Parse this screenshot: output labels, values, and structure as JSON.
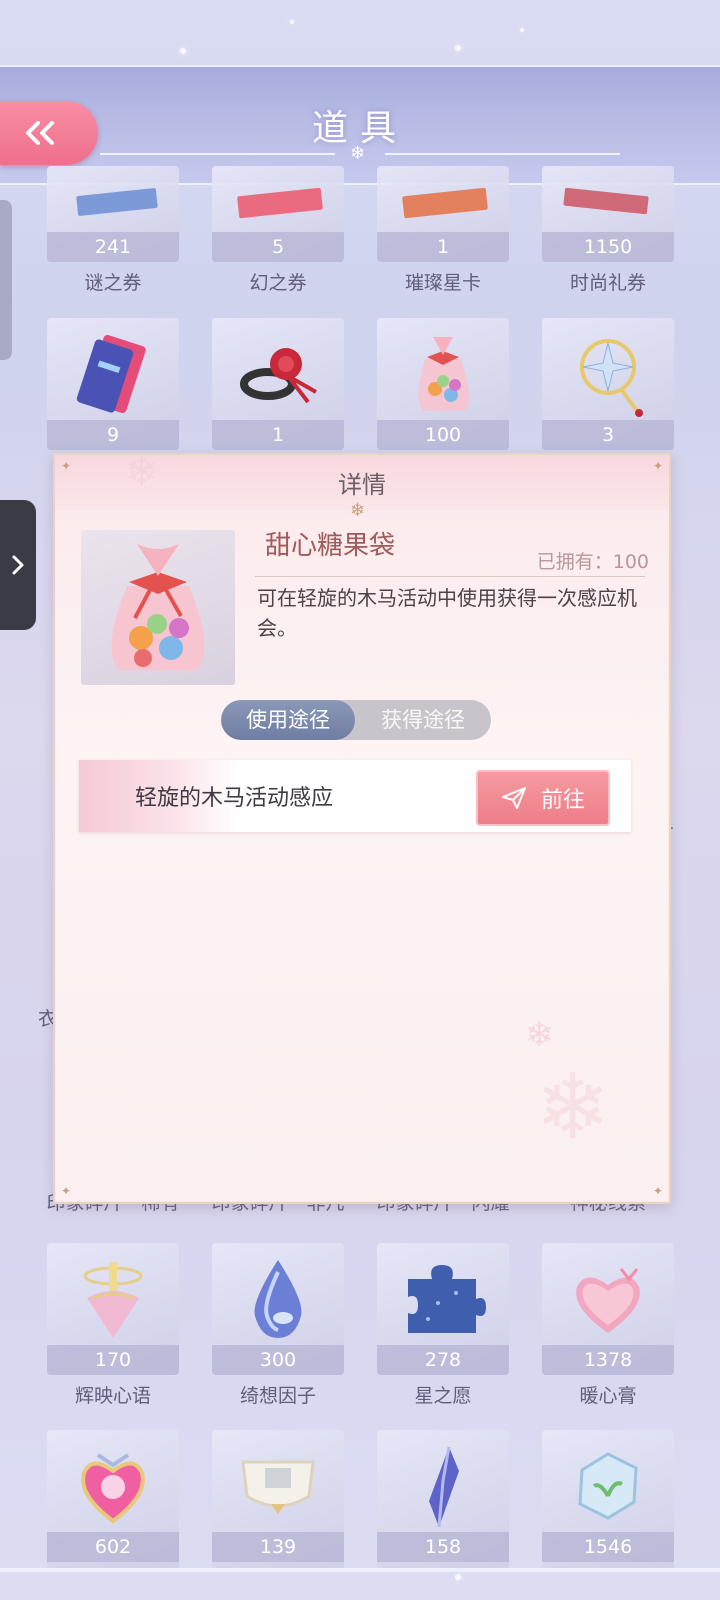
{
  "header": {
    "title": "道具",
    "back_icon": "double-chevron-left-icon"
  },
  "side_tab": {
    "icon": "chevron-right-icon"
  },
  "items": [
    {
      "name": "谜之券",
      "count": "241",
      "icon": "ticket-icon"
    },
    {
      "name": "幻之券",
      "count": "5",
      "icon": "ticket-icon"
    },
    {
      "name": "璀璨星卡",
      "count": "1",
      "icon": "card-icon"
    },
    {
      "name": "时尚礼券",
      "count": "1150",
      "icon": "voucher-icon"
    },
    {
      "name": "",
      "count": "9",
      "icon": "ticket-bundle-icon"
    },
    {
      "name": "",
      "count": "1",
      "icon": "rose-ring-icon"
    },
    {
      "name": "",
      "count": "100",
      "icon": "candy-bag-icon"
    },
    {
      "name": "",
      "count": "3",
      "icon": "star-wand-icon"
    },
    {
      "name": "印象碎片・稀有",
      "count": "",
      "icon": ""
    },
    {
      "name": "印象碎片・非凡",
      "count": "",
      "icon": ""
    },
    {
      "name": "印象碎片・闪耀",
      "count": "",
      "icon": ""
    },
    {
      "name": "神秘线索",
      "count": "",
      "icon": ""
    },
    {
      "name": "辉映心语",
      "count": "170",
      "icon": "spinning-top-icon"
    },
    {
      "name": "绮想因子",
      "count": "300",
      "icon": "water-drop-icon"
    },
    {
      "name": "星之愿",
      "count": "278",
      "icon": "puzzle-piece-icon"
    },
    {
      "name": "暖心膏",
      "count": "1378",
      "icon": "heart-box-icon"
    },
    {
      "name": "",
      "count": "602",
      "icon": "heart-brooch-icon"
    },
    {
      "name": "",
      "count": "139",
      "icon": "compact-icon"
    },
    {
      "name": "",
      "count": "158",
      "icon": "crystal-icon"
    },
    {
      "name": "",
      "count": "1546",
      "icon": "ice-cube-icon"
    }
  ],
  "side_peek_text": [
    "有",
    "衣"
  ],
  "detail": {
    "title": "详情",
    "item_name": "甜心糖果袋",
    "owned": "已拥有：100",
    "description": "可在轻旋的木马活动中使用获得一次感应机会。",
    "tabs": [
      "使用途径",
      "获得途径"
    ],
    "active_tab": "使用途径",
    "route_label": "轻旋的木马活动感应",
    "go_label": "前往",
    "go_icon": "paper-plane-icon",
    "item_icon": "candy-bag-icon"
  },
  "colors": {
    "accent": "#ee7e88",
    "back_button": "#f37f97",
    "header": "#b4b8e3",
    "toggle_active": "#7886aa"
  }
}
